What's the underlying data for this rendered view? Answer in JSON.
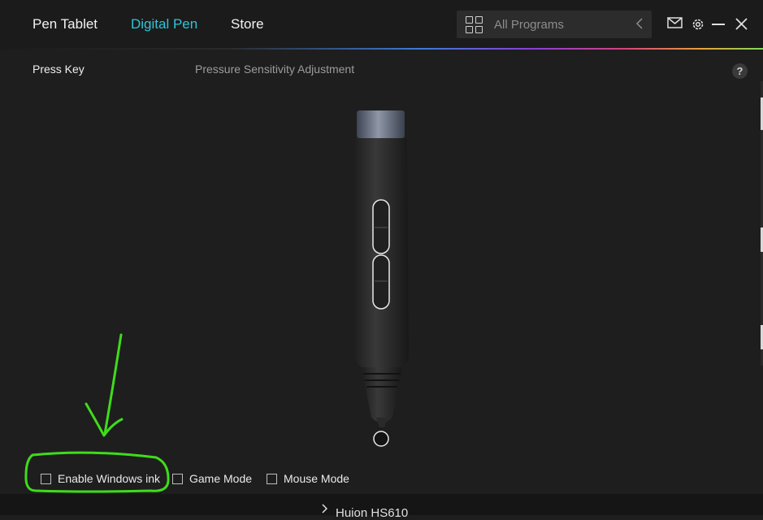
{
  "nav": {
    "tabs": [
      {
        "label": "Pen Tablet",
        "active": false
      },
      {
        "label": "Digital Pen",
        "active": true
      },
      {
        "label": "Store",
        "active": false
      }
    ]
  },
  "search": {
    "placeholder": "All Programs"
  },
  "subtabs": {
    "press_key": "Press Key",
    "pressure": "Pressure Sensitivity Adjustment"
  },
  "help_label": "?",
  "options": [
    {
      "label": "Enable Windows ink",
      "checked": false
    },
    {
      "label": "Game Mode",
      "checked": false
    },
    {
      "label": "Mouse Mode",
      "checked": false
    }
  ],
  "device": {
    "name": "Huion HS610"
  },
  "colors": {
    "accent": "#2ec5d8",
    "background": "#1e1e1e",
    "annotation": "#3fdc1a"
  },
  "icons": [
    "grid-icon",
    "chevron-left-icon",
    "mail-icon",
    "gear-icon",
    "minimize-icon",
    "close-icon",
    "chevron-right-icon",
    "help-icon"
  ]
}
